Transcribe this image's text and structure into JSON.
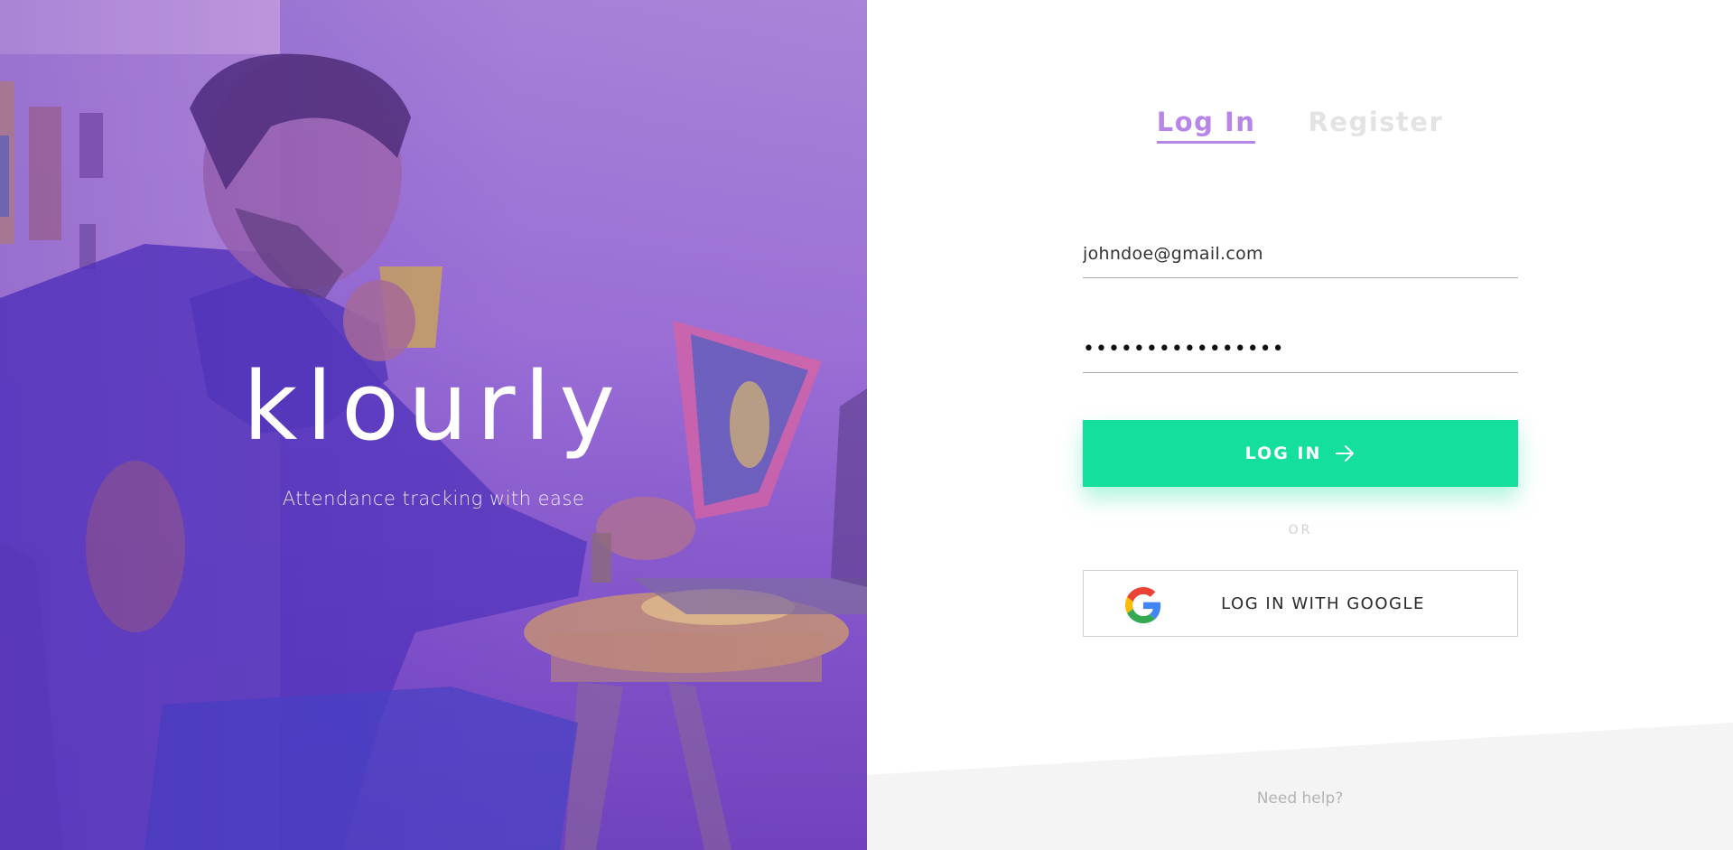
{
  "brand": {
    "name": "klourly",
    "tagline": "Attendance tracking with ease"
  },
  "tabs": [
    {
      "label": "Log In",
      "active": true
    },
    {
      "label": "Register",
      "active": false
    }
  ],
  "form": {
    "email_value": "johndoe@gmail.com",
    "password_value": "••••••••••••••••",
    "login_button_label": "LOG IN",
    "or_label": "OR",
    "google_button_label": "LOG IN WITH GOOGLE"
  },
  "footer": {
    "help_label": "Need help?"
  },
  "colors": {
    "accent_purple": "#b784e8",
    "accent_green": "#15df9d",
    "tab_inactive": "#e3e3e3",
    "footer_band": "#f4f4f4"
  },
  "icons": [
    "arrow-right-icon",
    "google-logo-icon"
  ]
}
